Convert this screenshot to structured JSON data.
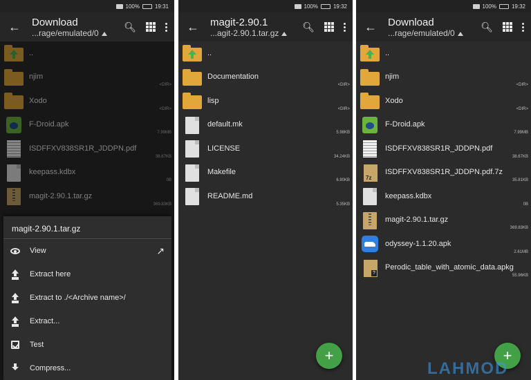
{
  "status": {
    "battery": "100%",
    "time_left": "19:31",
    "time_mid": "19:32",
    "time_right": "19:32"
  },
  "panel1": {
    "title": "Download",
    "subtitle": "...rage/emulated/0",
    "items": [
      {
        "name": "..",
        "meta": ""
      },
      {
        "name": "njim",
        "meta": "<DIR>"
      },
      {
        "name": "Xodo",
        "meta": "<DIR>"
      },
      {
        "name": "F-Droid.apk",
        "meta": "7.99MB"
      },
      {
        "name": "ISDFFXV838SR1R_JDDPN.pdf",
        "meta": "38.67KB"
      },
      {
        "name": "keepass.kdbx",
        "meta": "0B"
      },
      {
        "name": "magit-2.90.1.tar.gz",
        "meta": "369.83KB"
      }
    ],
    "sheet": {
      "title": "magit-2.90.1.tar.gz",
      "items": [
        "View",
        "Extract here",
        "Extract to ./<Archive name>/",
        "Extract...",
        "Test",
        "Compress..."
      ]
    }
  },
  "panel2": {
    "title": "magit-2.90.1",
    "subtitle": "...agit-2.90.1.tar.gz",
    "items": [
      {
        "name": "..",
        "meta": ""
      },
      {
        "name": "Documentation",
        "meta": "<DIR>"
      },
      {
        "name": "lisp",
        "meta": "<DIR>"
      },
      {
        "name": "default.mk",
        "meta": "5.98KB"
      },
      {
        "name": "LICENSE",
        "meta": "34.24KB"
      },
      {
        "name": "Makefile",
        "meta": "6.90KB"
      },
      {
        "name": "README.md",
        "meta": "5.35KB"
      }
    ],
    "fab": "+"
  },
  "panel3": {
    "title": "Download",
    "subtitle": "...rage/emulated/0",
    "items": [
      {
        "name": "..",
        "meta": ""
      },
      {
        "name": "njim",
        "meta": "<DIR>"
      },
      {
        "name": "Xodo",
        "meta": "<DIR>"
      },
      {
        "name": "F-Droid.apk",
        "meta": "7.99MB"
      },
      {
        "name": "ISDFFXV838SR1R_JDDPN.pdf",
        "meta": "38.67KB"
      },
      {
        "name": "ISDFFXV838SR1R_JDDPN.pdf.7z",
        "meta": "35.81KB"
      },
      {
        "name": "keepass.kdbx",
        "meta": "0B"
      },
      {
        "name": "magit-2.90.1.tar.gz",
        "meta": "369.83KB"
      },
      {
        "name": "odyssey-1.1.20.apk",
        "meta": "2.61MB"
      },
      {
        "name": "Perodic_table_with_atomic_data.apkg",
        "meta": "55.96KB"
      }
    ],
    "fab": "+"
  },
  "watermark": "LAHMOD"
}
